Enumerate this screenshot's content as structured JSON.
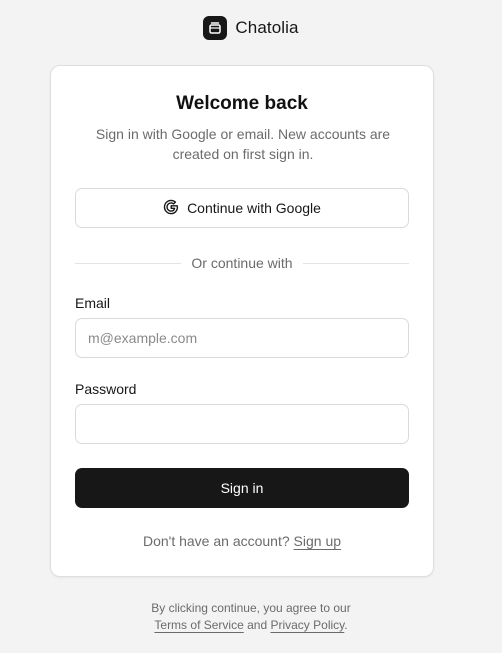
{
  "brand": {
    "name": "Chatolia",
    "icon": "box-logo-icon"
  },
  "card": {
    "title": "Welcome back",
    "subtitle": "Sign in with Google or email. New accounts are created on first sign in.",
    "google_button_label": "Continue with Google",
    "divider_text": "Or continue with",
    "email": {
      "label": "Email",
      "placeholder": "m@example.com",
      "value": ""
    },
    "password": {
      "label": "Password",
      "placeholder": "",
      "value": ""
    },
    "signin_button_label": "Sign in",
    "signup_prompt": "Don't have an account?",
    "signup_link": "Sign up"
  },
  "footer": {
    "line1": "By clicking continue, you agree to our",
    "terms_link": "Terms of Service",
    "and_text": "and",
    "privacy_link": "Privacy Policy",
    "period": "."
  },
  "colors": {
    "primary": "#171717",
    "background": "#f3f3f3",
    "muted_text": "#6b6b6b",
    "border": "#dadada"
  }
}
